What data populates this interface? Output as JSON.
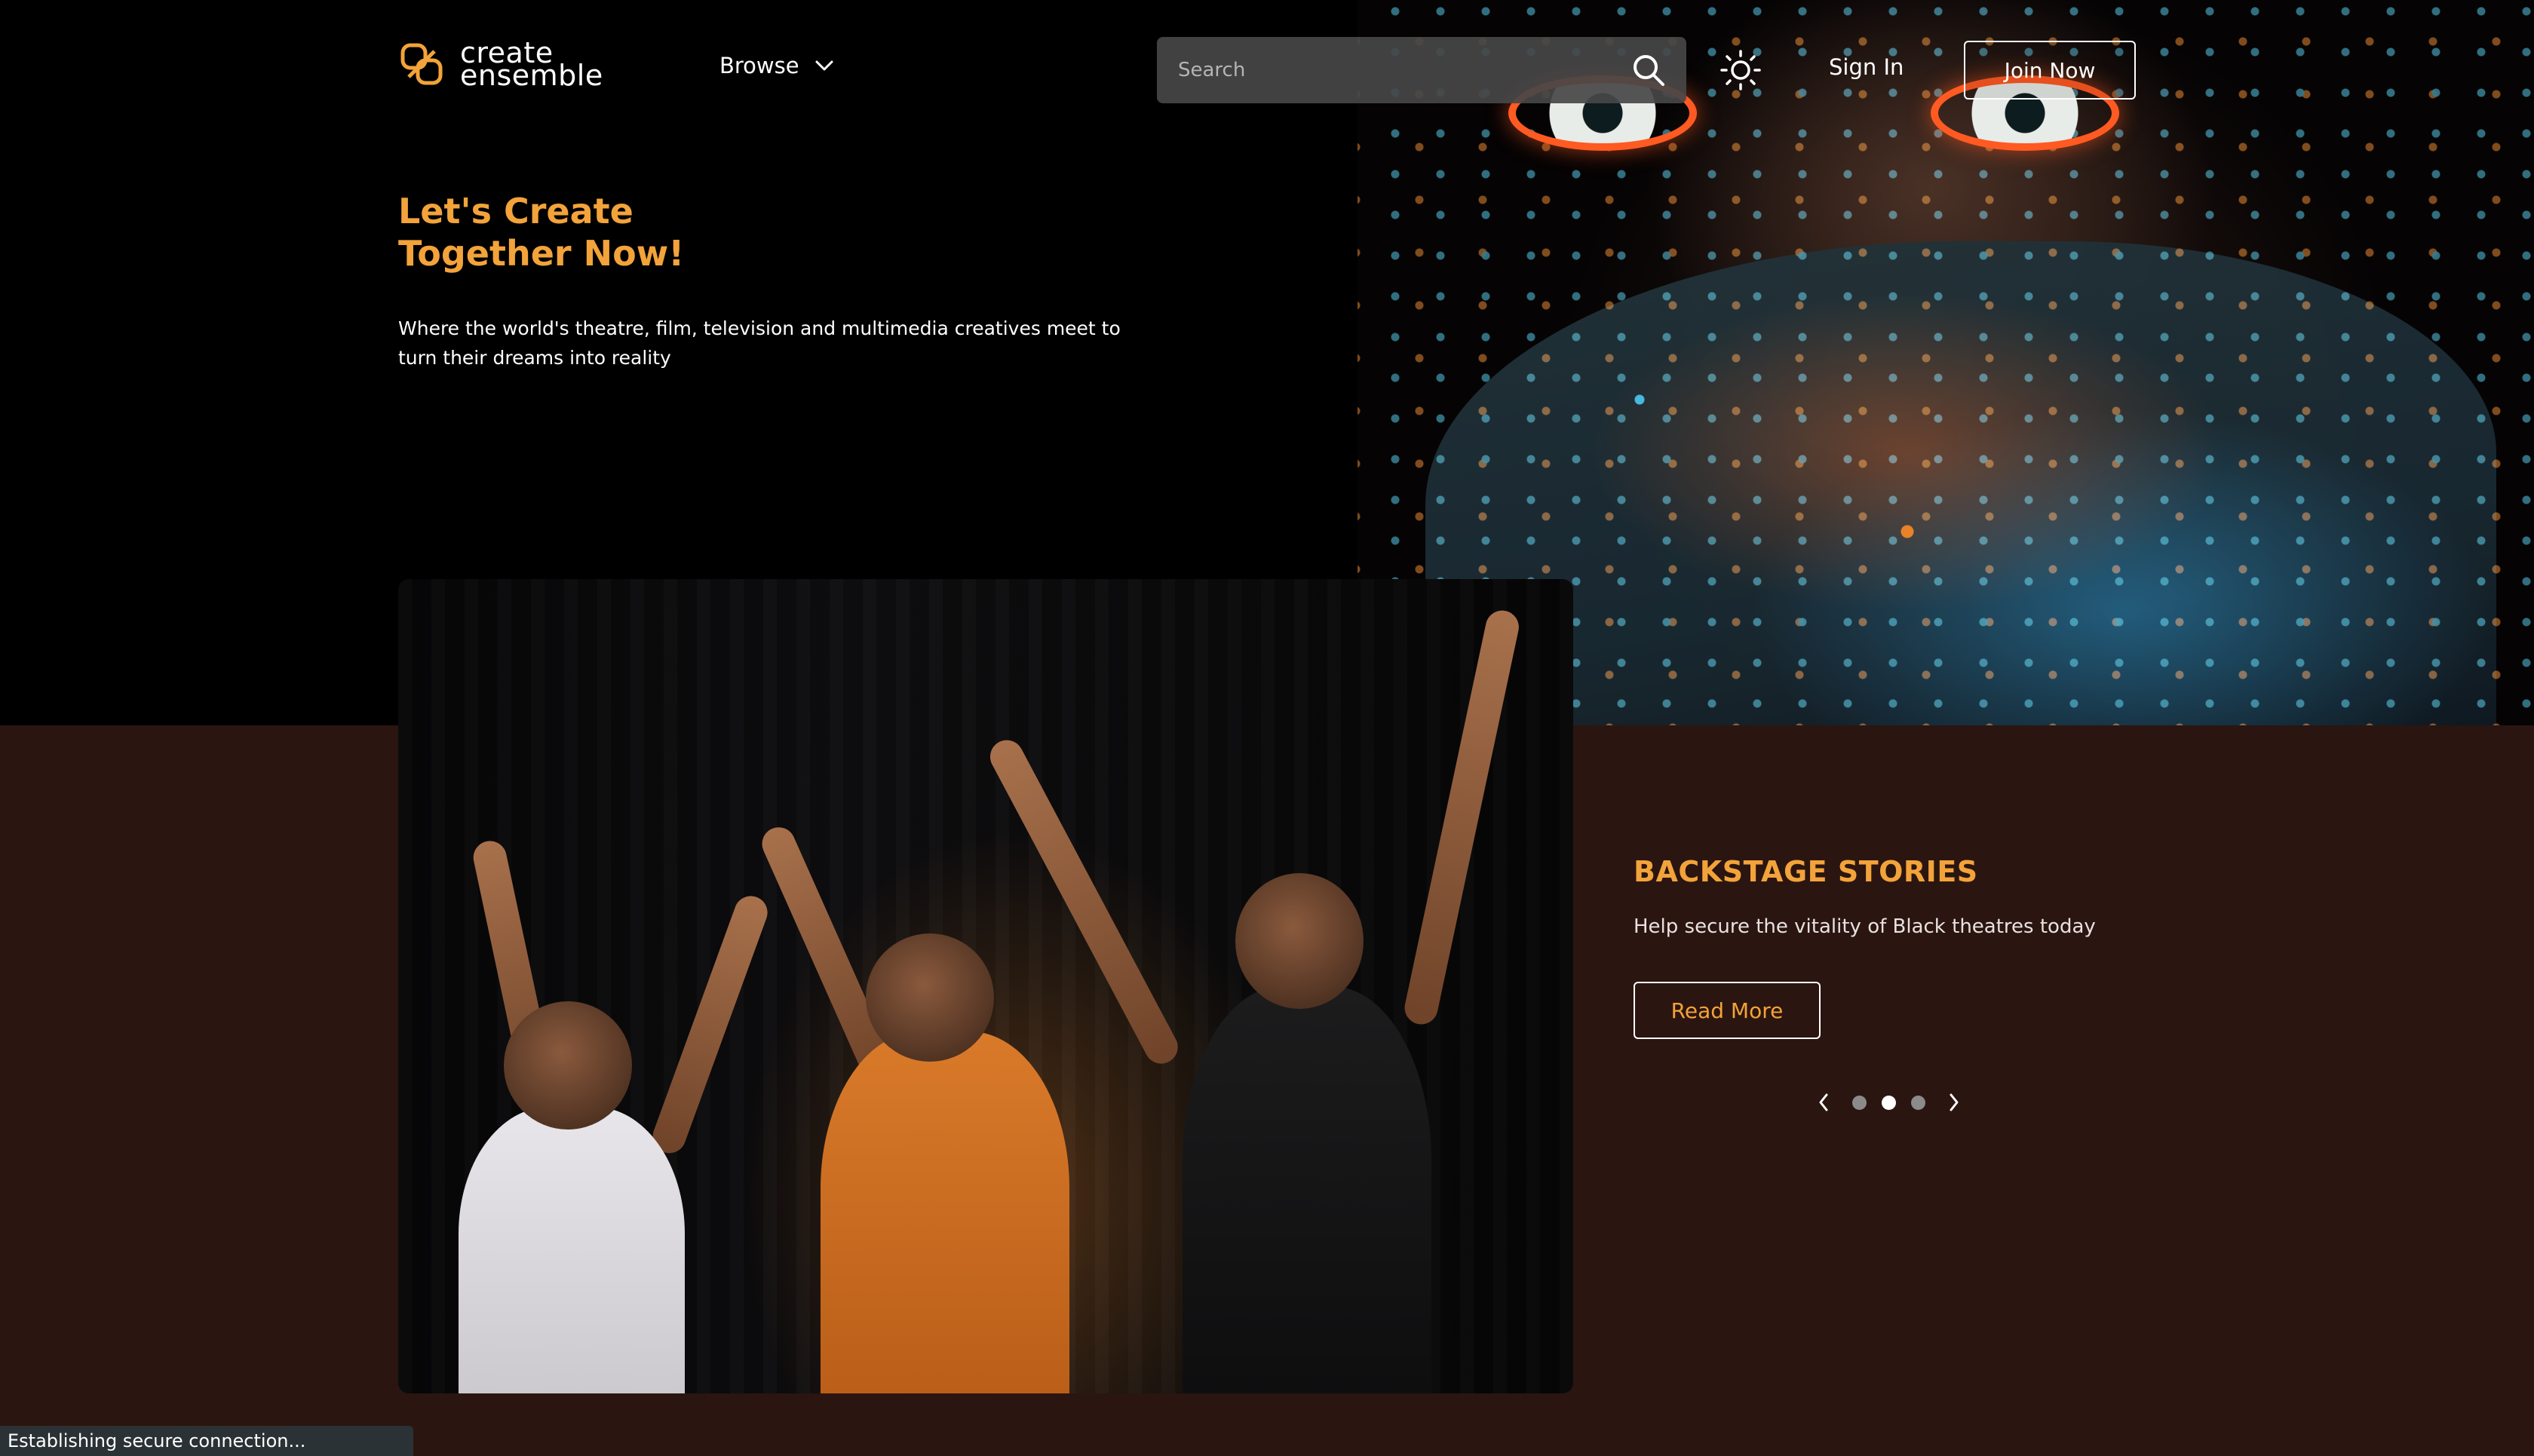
{
  "header": {
    "logo_line1": "create",
    "logo_line2": "ensemble",
    "browse_label": "Browse",
    "search_placeholder": "Search",
    "signin_label": "Sign In",
    "join_label": "Join Now"
  },
  "hero": {
    "title_line1": "Let's Create",
    "title_line2": "Together Now!",
    "subtitle": "Where the world's theatre, film, television and multimedia creatives meet to turn their dreams into reality"
  },
  "feature": {
    "title": "BACKSTAGE STORIES",
    "subtitle": "Help secure the vitality of Black theatres today",
    "button_label": "Read More",
    "carousel": {
      "slide_count": 3,
      "active_index": 1
    }
  },
  "browser_status": {
    "text": "Establishing secure connection..."
  },
  "colors": {
    "accent": "#f2a33a",
    "hero_background": "#000000",
    "band_background": "#2b1510",
    "search_background": "#464648"
  },
  "icons": {
    "logo": "create-ensemble-logo-icon",
    "browse_chevron": "chevron-down-icon",
    "search": "search-icon",
    "theme": "sun-icon",
    "prev": "chevron-left-icon",
    "next": "chevron-right-icon"
  }
}
